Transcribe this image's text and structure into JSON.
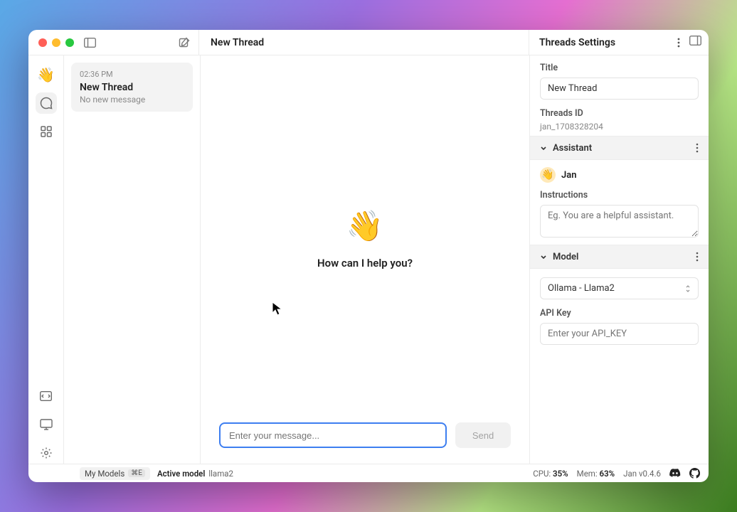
{
  "header": {
    "center_title": "New Thread",
    "right_title": "Threads Settings"
  },
  "threads": [
    {
      "time": "02:36 PM",
      "title": "New Thread",
      "subtitle": "No new message"
    }
  ],
  "hero": {
    "wave": "👋",
    "prompt": "How can I help you?"
  },
  "composer": {
    "placeholder": "Enter your message...",
    "value": "",
    "send_label": "Send"
  },
  "settings": {
    "title_label": "Title",
    "title_value": "New Thread",
    "threads_id_label": "Threads ID",
    "threads_id_value": "jan_1708328204",
    "assistant_section": "Assistant",
    "assistant": {
      "avatar": "👋",
      "name": "Jan"
    },
    "instructions_label": "Instructions",
    "instructions_placeholder": "Eg. You are a helpful assistant.",
    "model_section": "Model",
    "model_selected": "Ollama - Llama2",
    "api_key_label": "API Key",
    "api_key_placeholder": "Enter your API_KEY"
  },
  "statusbar": {
    "my_models_label": "My Models",
    "my_models_kbd": "⌘E",
    "active_model_label": "Active model",
    "active_model_value": "llama2",
    "cpu_label": "CPU:",
    "cpu_value": "35%",
    "mem_label": "Mem:",
    "mem_value": "63%",
    "version": "Jan v0.4.6"
  }
}
